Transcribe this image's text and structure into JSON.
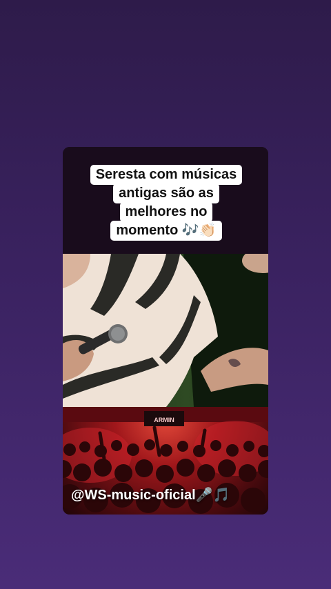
{
  "caption": {
    "lines": [
      "Seresta com músicas",
      "antigas são as",
      "melhores no",
      "momento 🎶👏🏻"
    ]
  },
  "watermark": {
    "text": "@WS-music-oficial🎤🎵"
  },
  "concert": {
    "screen_text": "ARMIN"
  },
  "colors": {
    "background_top": "#2e1b4a",
    "background_bottom": "#4a2c78",
    "stage_red": "#c8222a",
    "shirt": "#efe2d6"
  }
}
